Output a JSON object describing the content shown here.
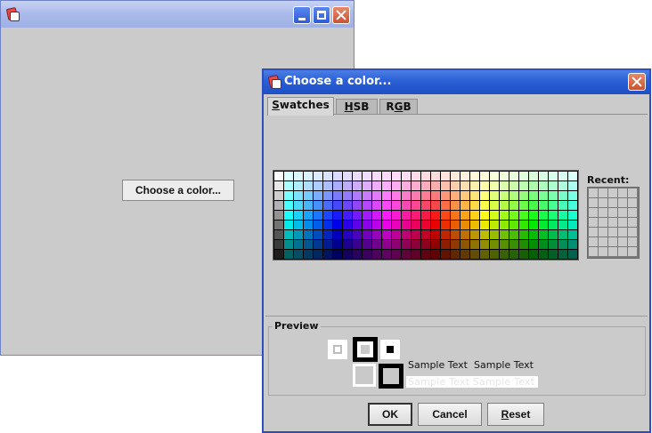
{
  "main_window": {
    "title": "",
    "icon": "java-coffee-icon",
    "button_label": "Choose a color...",
    "controls": [
      "minimize-icon",
      "maximize-icon",
      "close-icon"
    ]
  },
  "dialog": {
    "title": "Choose a color...",
    "icon": "java-coffee-icon",
    "tabs": [
      {
        "label": "Swatches",
        "mnemonic": "S",
        "selected": true
      },
      {
        "label": "HSB",
        "mnemonic": "H",
        "selected": false
      },
      {
        "label": "RGB",
        "mnemonic": "G",
        "selected": false
      }
    ],
    "recent_label": "Recent:",
    "preview_label": "Preview",
    "sample_text": "Sample Text",
    "buttons": {
      "ok": "OK",
      "cancel": "Cancel",
      "reset": "Reset"
    },
    "reset_mnemonic": "R",
    "colors": {
      "title_bar": "#245edb",
      "panel_bg": "#cbcbcb",
      "close_button": "#d9643f"
    }
  }
}
